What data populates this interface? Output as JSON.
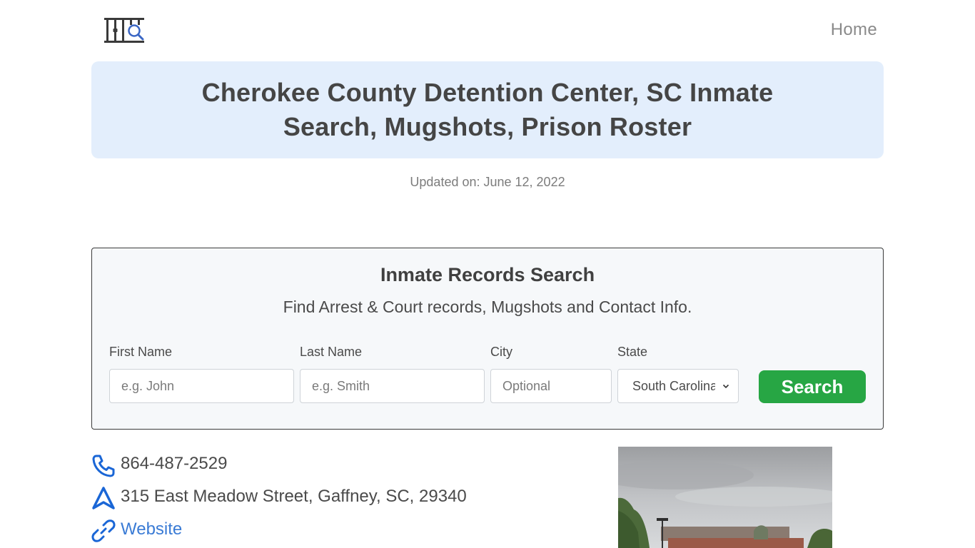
{
  "header": {
    "logo_icon": "jail-bars-search-icon",
    "nav": {
      "home_label": "Home"
    }
  },
  "hero": {
    "title": "Cherokee County Detention Center, SC Inmate Search, Mugshots, Prison Roster"
  },
  "updated": "Updated on: June 12, 2022",
  "search": {
    "title": "Inmate Records Search",
    "subtitle": "Find Arrest & Court records, Mugshots and Contact Info.",
    "fields": {
      "first_name": {
        "label": "First Name",
        "placeholder": "e.g. John",
        "value": ""
      },
      "last_name": {
        "label": "Last Name",
        "placeholder": "e.g. Smith",
        "value": ""
      },
      "city": {
        "label": "City",
        "placeholder": "Optional",
        "value": ""
      },
      "state": {
        "label": "State",
        "selected": "South Carolina"
      }
    },
    "button_label": "Search",
    "button_color": "#27a644"
  },
  "contact": {
    "phone": {
      "icon": "phone-icon",
      "text": "864-487-2529"
    },
    "address": {
      "icon": "navigation-arrow-icon",
      "text": "315 East Meadow Street, Gaffney, SC, 29340"
    },
    "website": {
      "icon": "link-icon",
      "text": "Website"
    },
    "accent_color": "#1a66d6"
  },
  "photo": {
    "alt": "Street view of Cherokee County Detention Center"
  }
}
